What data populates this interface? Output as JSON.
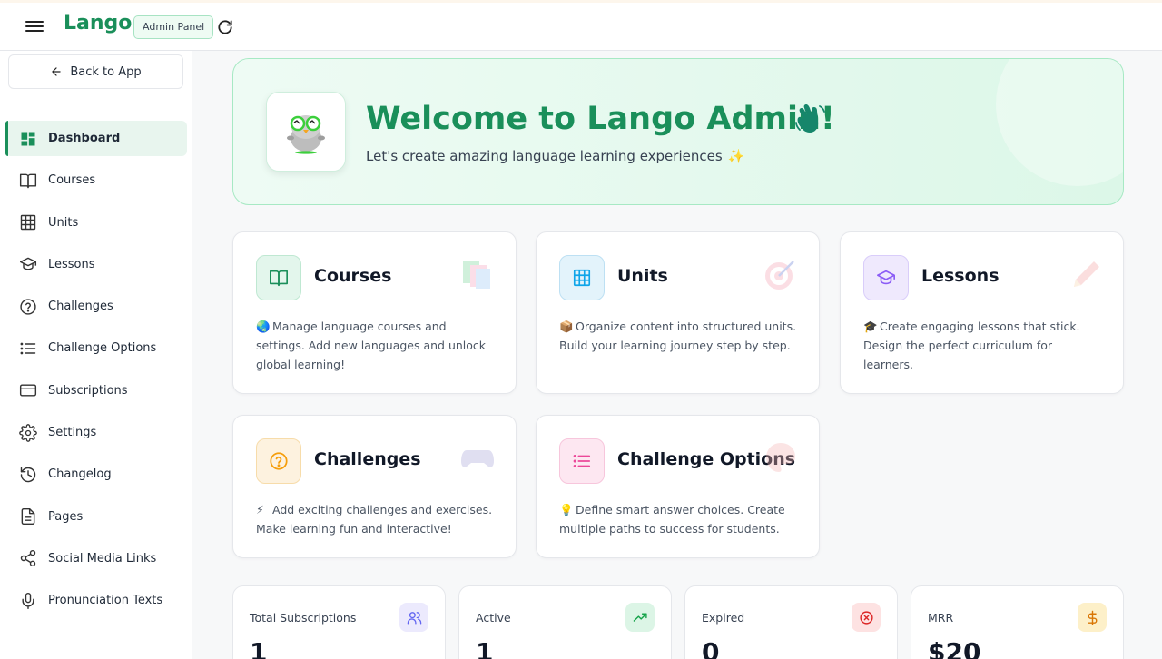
{
  "topbar": {
    "brand": "Lango",
    "badge": "Admin Panel",
    "brand_color": "#1a8f5a"
  },
  "sidebar": {
    "back_label": "Back to App",
    "items": [
      {
        "label": "Dashboard",
        "icon": "dashboard-icon",
        "active": true
      },
      {
        "label": "Courses",
        "icon": "book-icon"
      },
      {
        "label": "Units",
        "icon": "grid-icon"
      },
      {
        "label": "Lessons",
        "icon": "graduation-cap-icon"
      },
      {
        "label": "Challenges",
        "icon": "help-circle-icon"
      },
      {
        "label": "Challenge Options",
        "icon": "list-icon"
      },
      {
        "label": "Subscriptions",
        "icon": "credit-card-icon"
      },
      {
        "label": "Settings",
        "icon": "gear-icon"
      },
      {
        "label": "Changelog",
        "icon": "history-icon"
      },
      {
        "label": "Pages",
        "icon": "file-icon"
      },
      {
        "label": "Social Media Links",
        "icon": "share-icon"
      },
      {
        "label": "Pronunciation Texts",
        "icon": "microphone-icon"
      }
    ]
  },
  "hero": {
    "title": "Welcome to Lango Admin!",
    "subtitle": "Let's create amazing language learning experiences",
    "wave_icon": "waving-hand-icon",
    "sparkle_icon": "sparkles-icon"
  },
  "cards": [
    {
      "title": "Courses",
      "emoji": "🌏",
      "desc": "Manage language courses and settings. Add new languages and unlock global learning!",
      "icon": "book-icon",
      "accent": "#1a8f5a",
      "bg": "#e3f6ec"
    },
    {
      "title": "Units",
      "emoji": "📦",
      "desc": "Organize content into structured units. Build your learning journey step by step.",
      "icon": "grid-icon",
      "accent": "#0ea5e9",
      "bg": "#e3f3fb"
    },
    {
      "title": "Lessons",
      "emoji": "🎓",
      "desc": "Create engaging lessons that stick. Design the perfect curriculum for learners.",
      "icon": "graduation-cap-icon",
      "accent": "#8b5cf6",
      "bg": "#efe9fd"
    },
    {
      "title": "Challenges",
      "emoji": "⚡",
      "desc": "Add exciting challenges and exercises. Make learning fun and interactive!",
      "icon": "help-circle-icon",
      "accent": "#f59e0b",
      "bg": "#fdf2df"
    },
    {
      "title": "Challenge Options",
      "emoji": "💡",
      "desc": "Define smart answer choices. Create multiple paths to success for students.",
      "icon": "list-icon",
      "accent": "#ec4899",
      "bg": "#fde7f1"
    }
  ],
  "stats": [
    {
      "label": "Total Subscriptions",
      "value": "1",
      "icon": "users-icon",
      "color": "#6366f1",
      "bg": "#eceafd"
    },
    {
      "label": "Active",
      "value": "1",
      "icon": "trending-up-icon",
      "color": "#16a34a",
      "bg": "#dcf5e6"
    },
    {
      "label": "Expired",
      "value": "0",
      "icon": "x-circle-icon",
      "color": "#dc2626",
      "bg": "#fde2e2"
    },
    {
      "label": "MRR",
      "value": "$20",
      "icon": "dollar-icon",
      "color": "#d97706",
      "bg": "#fdf0c9"
    }
  ]
}
